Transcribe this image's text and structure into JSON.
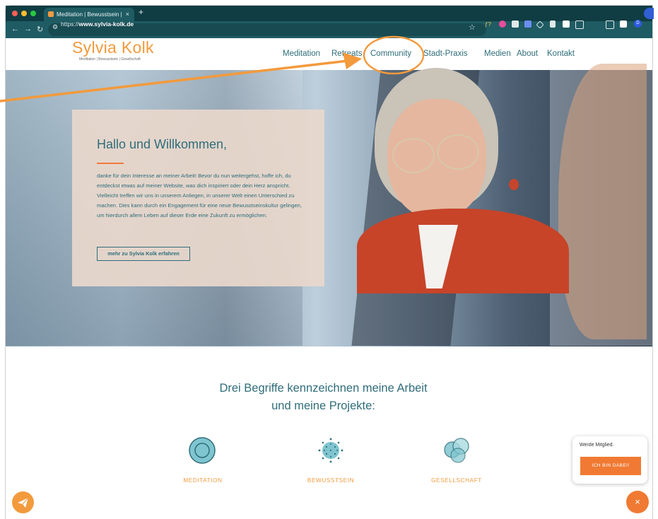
{
  "browser": {
    "tab_title": "Meditation | Bewusstsein | Ge",
    "new_tab": "+",
    "url_prefix": "https://",
    "url_host": "www.sylvia-kolk.de",
    "profile_initial": "D"
  },
  "site": {
    "logo": "Sylvia Kolk",
    "tagline": "Meditation | Bewusstsein | Gesellschaft",
    "nav": [
      "Meditation",
      "Retreats",
      "Community",
      "Stadt-Praxis",
      "Medien",
      "About",
      "Kontakt"
    ]
  },
  "hero": {
    "title": "Hallo und Willkommen,",
    "text": "danke für dein Interesse an meiner Arbeit! Bevor du nun weitergehst, hoffe ich, du entdeckst etwas auf meiner Website, was dich inspiriert oder dein Herz anspricht. Vielleicht treffen wir uns in unserem Anliegen, in unserer Welt einen Unterschied zu machen. Dies kann durch ein Engagement für eine neue Bewusstseinskultur gelingen, um hierdurch allem Leben auf dieser Erde eine Zukunft zu ermöglichen.",
    "button": "mehr zu Sylvia Kolk erfahren"
  },
  "section": {
    "title_line1": "Drei Begriffe kennzeichnen meine Arbeit",
    "title_line2": "und meine Projekte:",
    "concepts": [
      "MEDITATION",
      "BEWUSSTSEIN",
      "GESELLSCHAFT"
    ]
  },
  "widgets": {
    "member_text": "Werde Mitglied.",
    "member_button": "ICH BIN DABEI!",
    "close": "×"
  },
  "colors": {
    "accent_orange": "#f39a3c",
    "brand_teal": "#2f6d7a",
    "annotation": "#f39a3c"
  }
}
